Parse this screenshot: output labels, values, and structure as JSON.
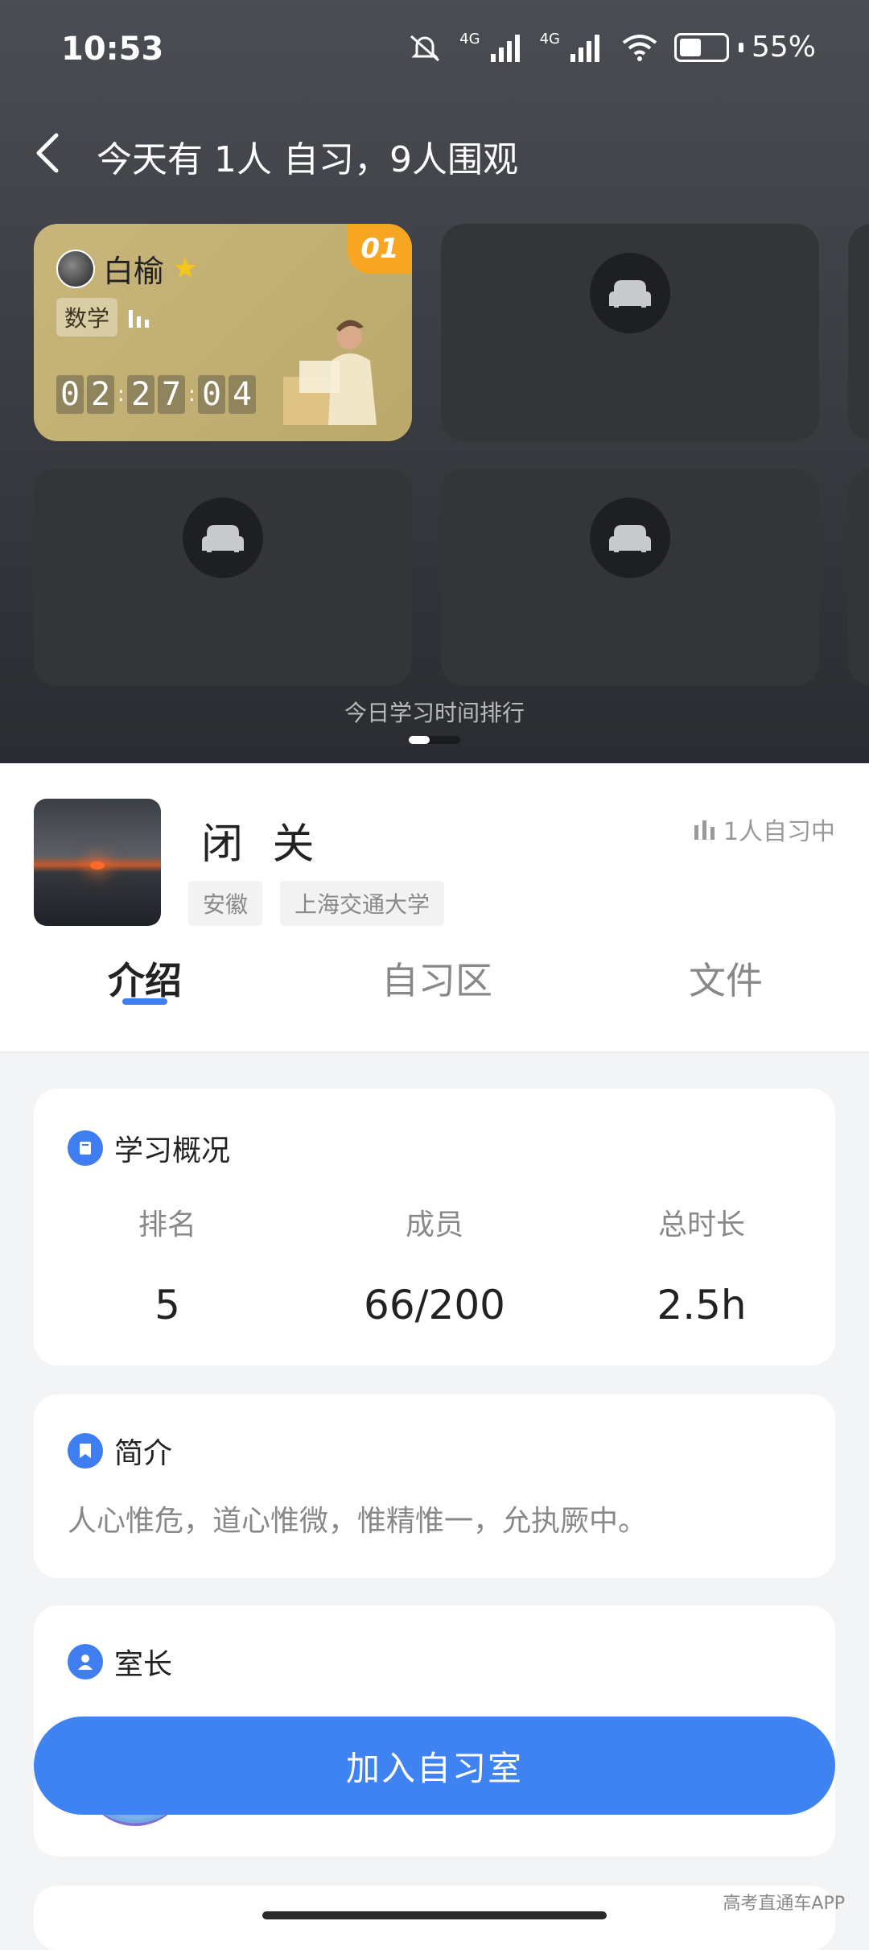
{
  "status_bar": {
    "time": "10:53",
    "battery": "55%",
    "network_1": "4G",
    "network_2": "4G",
    "icons": [
      "mute-icon",
      "signal-icon",
      "signal-icon",
      "wifi-icon",
      "battery-icon"
    ]
  },
  "header": {
    "title": "今天有 1人 自习，9人围观"
  },
  "seats": {
    "user": {
      "rank": "01",
      "name": "白榆",
      "subject": "数学",
      "timer": [
        "0",
        "2",
        "2",
        "7",
        "0",
        "4"
      ]
    },
    "empty_icon": "sofa-icon"
  },
  "ranking": {
    "caption": "今日学习时间排行"
  },
  "room": {
    "name": "闭 关",
    "status": "1人自习中",
    "tags": [
      "安徽",
      "上海交通大学"
    ]
  },
  "tabs": [
    {
      "label": "介绍",
      "active": true
    },
    {
      "label": "自习区",
      "active": false
    },
    {
      "label": "文件",
      "active": false
    }
  ],
  "overview": {
    "title": "学习概况",
    "stats": [
      {
        "label": "排名",
        "value": "5"
      },
      {
        "label": "成员",
        "value": "66/200"
      },
      {
        "label": "总时长",
        "value": "2.5h"
      }
    ]
  },
  "intro": {
    "title": "简介",
    "text": "人心惟危，道心惟微，惟精惟一，允执厥中。"
  },
  "owner": {
    "title": "室长"
  },
  "join_button": {
    "label": "加入自习室"
  },
  "watermark": "高考直通车APP",
  "colors": {
    "accent": "#3f82f2",
    "badge": "#f6a623",
    "seat_user_bg": "#c8b57a",
    "seat_empty_bg": "#333539"
  }
}
